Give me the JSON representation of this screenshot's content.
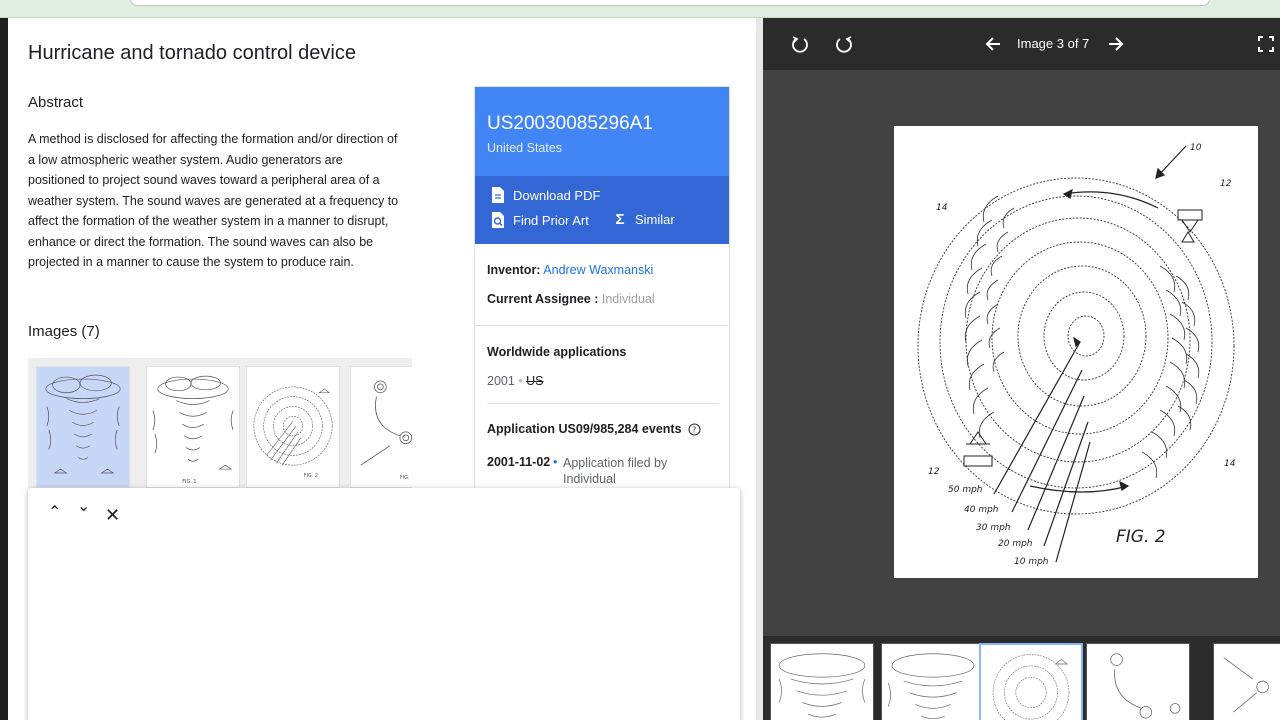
{
  "patent": {
    "title": "Hurricane and tornado control device",
    "abstract_heading": "Abstract",
    "abstract": "A method is disclosed for affecting the formation and/or direction of a low atmospheric weather system. Audio generators are positioned to project sound waves toward a peripheral area of a weather system. The sound waves are generated at a frequency to affect the formation of the weather system in a manner to disrupt, enhance or direct the formation. The sound waves can also be projected in a manner to cause the system to produce rain.",
    "images_heading": "Images (7)",
    "thumb_labels": [
      "FIG. 1",
      "FIG. 2",
      "FIG."
    ]
  },
  "card": {
    "number": "US20030085296A1",
    "country": "United States",
    "download_pdf": "Download PDF",
    "find_prior_art": "Find Prior Art",
    "similar": "Similar",
    "inventor_label": "Inventor:",
    "inventor": "Andrew Waxmanski",
    "assignee_label": "Current Assignee :",
    "assignee": "Individual",
    "worldwide_heading": "Worldwide applications",
    "worldwide_year": "2001",
    "worldwide_country": "US",
    "events_heading": "Application US09/985,284 events",
    "event_date": "2001-11-02",
    "event_text": "Application filed by Individual"
  },
  "find_bar": {
    "up": "⌃",
    "down": "⌄",
    "close": "✕"
  },
  "viewer": {
    "counter": "Image 3 of 7",
    "figure": {
      "title": "FIG. 2",
      "refs": [
        "10",
        "12",
        "14",
        "12",
        "14"
      ],
      "speeds": [
        "50 mph",
        "40 mph",
        "30 mph",
        "20 mph",
        "10 mph"
      ]
    }
  },
  "icons": {
    "rotate_left": "rotate-left-icon",
    "rotate_right": "rotate-right-icon",
    "prev": "arrow-left-icon",
    "next": "arrow-right-icon",
    "fullscreen": "fullscreen-icon",
    "pdf": "document-icon",
    "prior_art": "search-document-icon",
    "similar": "sigma-icon",
    "help": "help-circle-icon"
  },
  "colors": {
    "accent": "#4285f4",
    "accent_dark": "#3367d6",
    "link": "#1a73e8",
    "viewer_bg": "#424242"
  }
}
